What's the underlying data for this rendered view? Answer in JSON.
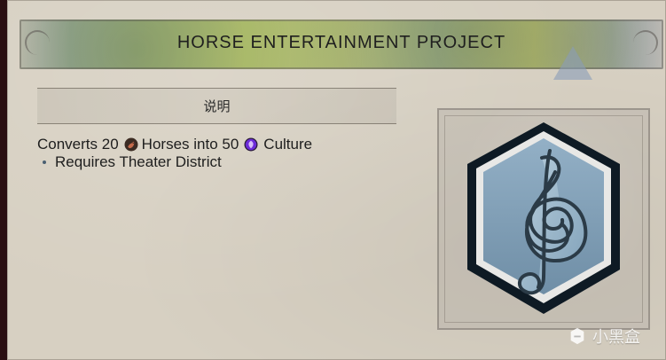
{
  "header": {
    "title": "HORSE ENTERTAINMENT PROJECT"
  },
  "section": {
    "title": "说明"
  },
  "description": {
    "line1": {
      "prefix": "Converts 20",
      "mid": "Horses into 50",
      "suffix": "Culture"
    },
    "requirement": "Requires Theater District"
  },
  "icons": {
    "resource_icon": "horse-icon",
    "yield_icon": "culture-icon",
    "project_icon": "music-note-icon"
  },
  "colors": {
    "parchment": "#d7d0c2",
    "badge_fill": "#7f9bb0",
    "badge_outline": "#0e1a24",
    "culture_purple": "#6c2bd9"
  },
  "watermark": {
    "text": "小黑盒"
  }
}
